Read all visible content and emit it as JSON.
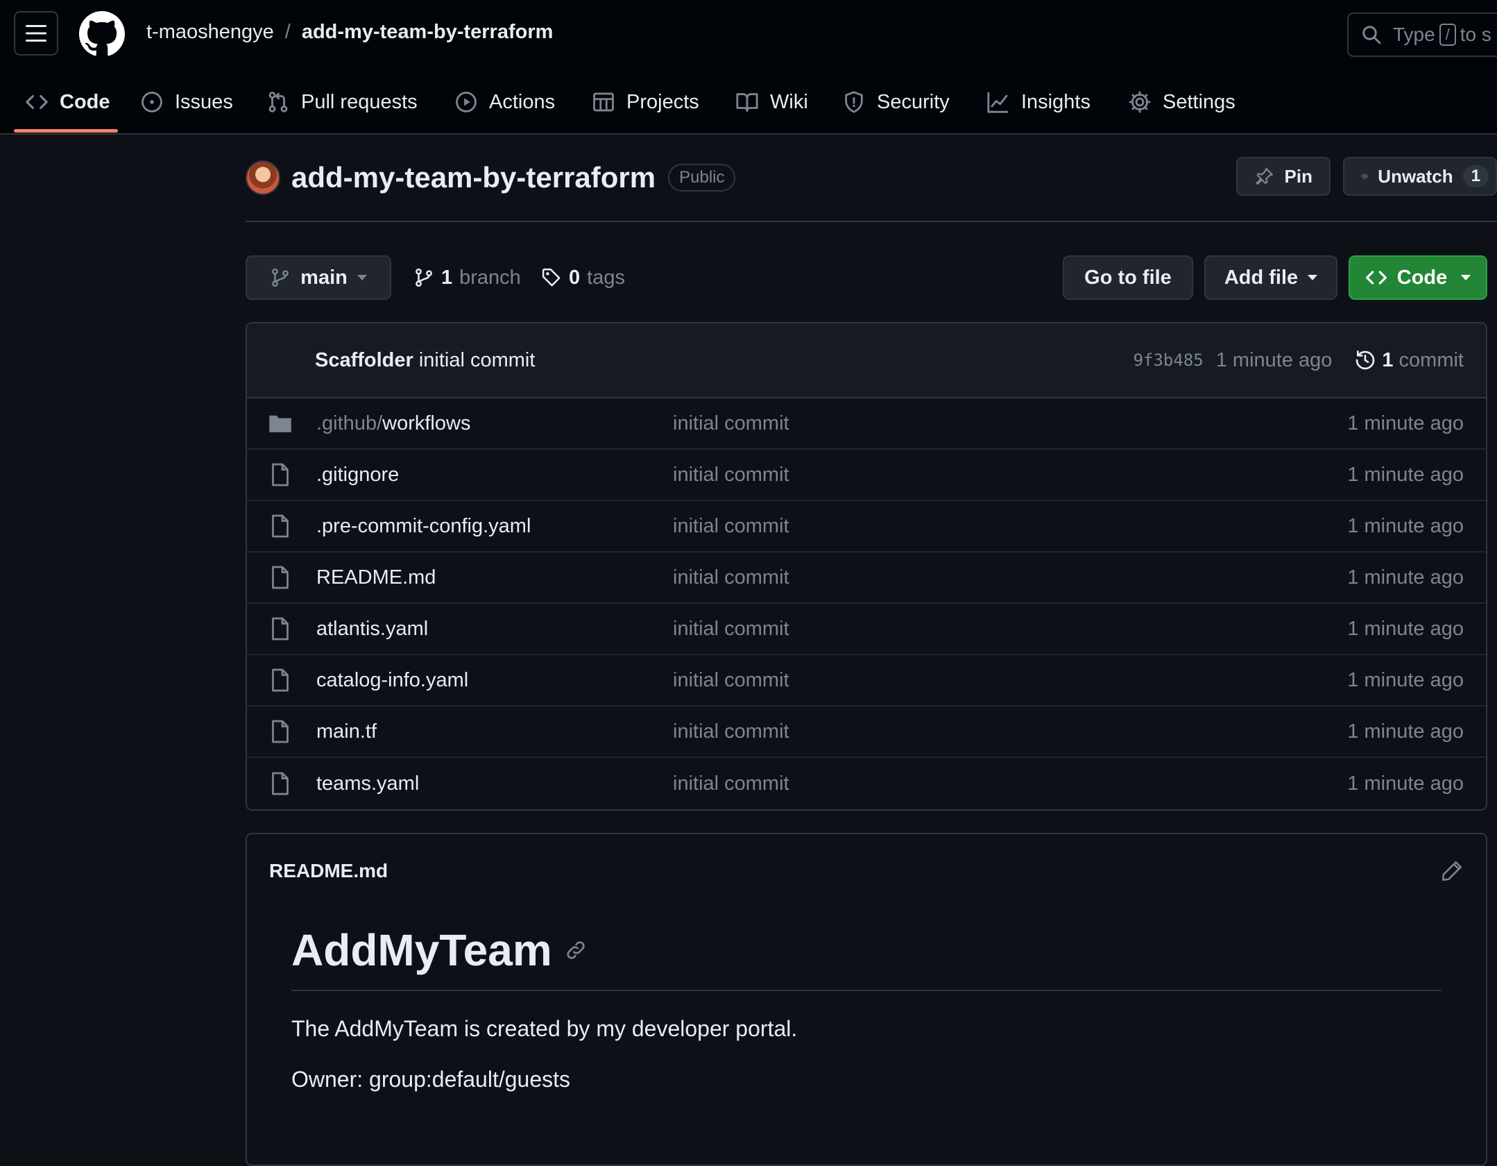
{
  "header": {
    "owner": "t-maoshengye",
    "separator": "/",
    "repo": "add-my-team-by-terraform",
    "search_prefix": "Type",
    "search_key": "/",
    "search_suffix": "to s"
  },
  "tabs": [
    {
      "label": "Code",
      "icon": "code-icon",
      "active": true
    },
    {
      "label": "Issues",
      "icon": "issue-icon"
    },
    {
      "label": "Pull requests",
      "icon": "pull-request-icon"
    },
    {
      "label": "Actions",
      "icon": "play-icon"
    },
    {
      "label": "Projects",
      "icon": "table-icon"
    },
    {
      "label": "Wiki",
      "icon": "book-icon"
    },
    {
      "label": "Security",
      "icon": "shield-icon"
    },
    {
      "label": "Insights",
      "icon": "graph-icon"
    },
    {
      "label": "Settings",
      "icon": "gear-icon"
    }
  ],
  "repo": {
    "name": "add-my-team-by-terraform",
    "visibility": "Public",
    "pin_label": "Pin",
    "unwatch_label": "Unwatch",
    "watch_count": "1"
  },
  "toolbar": {
    "branch": "main",
    "branch_count": "1",
    "branch_word": "branch",
    "tag_count": "0",
    "tag_word": "tags",
    "go_to_file": "Go to file",
    "add_file": "Add file",
    "code": "Code"
  },
  "latest_commit": {
    "author": "Scaffolder",
    "message": "initial commit",
    "sha": "9f3b485",
    "age": "1 minute ago",
    "commit_count": "1",
    "commit_word": "commit"
  },
  "files": [
    {
      "type": "folder",
      "prefix": ".github/",
      "name": "workflows",
      "message": "initial commit",
      "age": "1 minute ago"
    },
    {
      "type": "file",
      "prefix": "",
      "name": ".gitignore",
      "message": "initial commit",
      "age": "1 minute ago"
    },
    {
      "type": "file",
      "prefix": "",
      "name": ".pre-commit-config.yaml",
      "message": "initial commit",
      "age": "1 minute ago"
    },
    {
      "type": "file",
      "prefix": "",
      "name": "README.md",
      "message": "initial commit",
      "age": "1 minute ago"
    },
    {
      "type": "file",
      "prefix": "",
      "name": "atlantis.yaml",
      "message": "initial commit",
      "age": "1 minute ago"
    },
    {
      "type": "file",
      "prefix": "",
      "name": "catalog-info.yaml",
      "message": "initial commit",
      "age": "1 minute ago"
    },
    {
      "type": "file",
      "prefix": "",
      "name": "main.tf",
      "message": "initial commit",
      "age": "1 minute ago"
    },
    {
      "type": "file",
      "prefix": "",
      "name": "teams.yaml",
      "message": "initial commit",
      "age": "1 minute ago"
    }
  ],
  "readme": {
    "filename": "README.md",
    "title": "AddMyTeam",
    "paragraph1": "The AddMyTeam is created by my developer portal.",
    "paragraph2": "Owner: group:default/guests"
  }
}
